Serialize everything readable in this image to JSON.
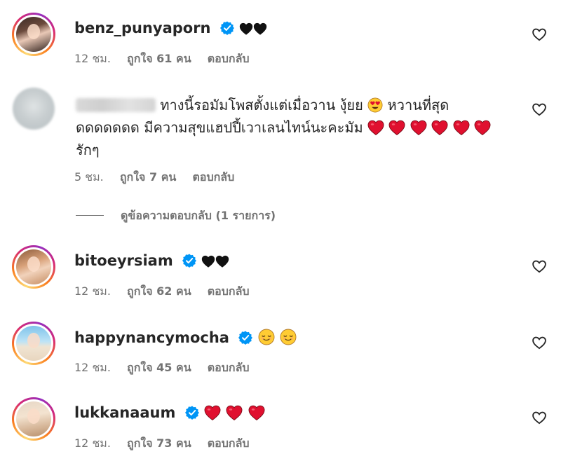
{
  "comments": [
    {
      "username": "benz_punyaporn",
      "verified": true,
      "emoji": [
        "black-heart",
        "black-heart"
      ],
      "time": "12 ชม.",
      "likes": "ถูกใจ 61 คน",
      "reply": "ตอบกลับ"
    },
    {
      "username": "",
      "text_part1": "ทางนี้รอมัมโพสตั้งแต่เมื่อวาน งุ้ยย",
      "text_part2": "หวานที่สุด",
      "text_line2": "ดดดดดดด มีความสุขแฮปปี้เวาเลนไทน์นะคะมัม",
      "text_line3": "รักๆ",
      "emoji": [
        "heart-eyes",
        "red-heart",
        "red-heart",
        "red-heart",
        "red-heart",
        "red-heart",
        "red-heart"
      ],
      "time": "5 ชม.",
      "likes": "ถูกใจ 7 คน",
      "reply": "ตอบกลับ",
      "view_replies": "ดูข้อความตอบกลับ (1 รายการ)"
    },
    {
      "username": "bitoeyrsiam",
      "verified": true,
      "emoji": [
        "black-heart",
        "black-heart"
      ],
      "time": "12 ชม.",
      "likes": "ถูกใจ 62 คน",
      "reply": "ตอบกลับ"
    },
    {
      "username": "happynancymocha",
      "verified": true,
      "emoji": [
        "relieved-face",
        "relieved-face"
      ],
      "time": "12 ชม.",
      "likes": "ถูกใจ 45 คน",
      "reply": "ตอบกลับ"
    },
    {
      "username": "lukkanaaum",
      "verified": true,
      "emoji": [
        "red-heart",
        "red-heart",
        "red-heart"
      ],
      "time": "12 ชม.",
      "likes": "ถูกใจ 73 คน",
      "reply": "ตอบกลับ"
    }
  ],
  "colors": {
    "verified_blue": "#0095f6",
    "red_heart": "#e0102f",
    "meta_gray": "#737373",
    "text": "#262626"
  }
}
